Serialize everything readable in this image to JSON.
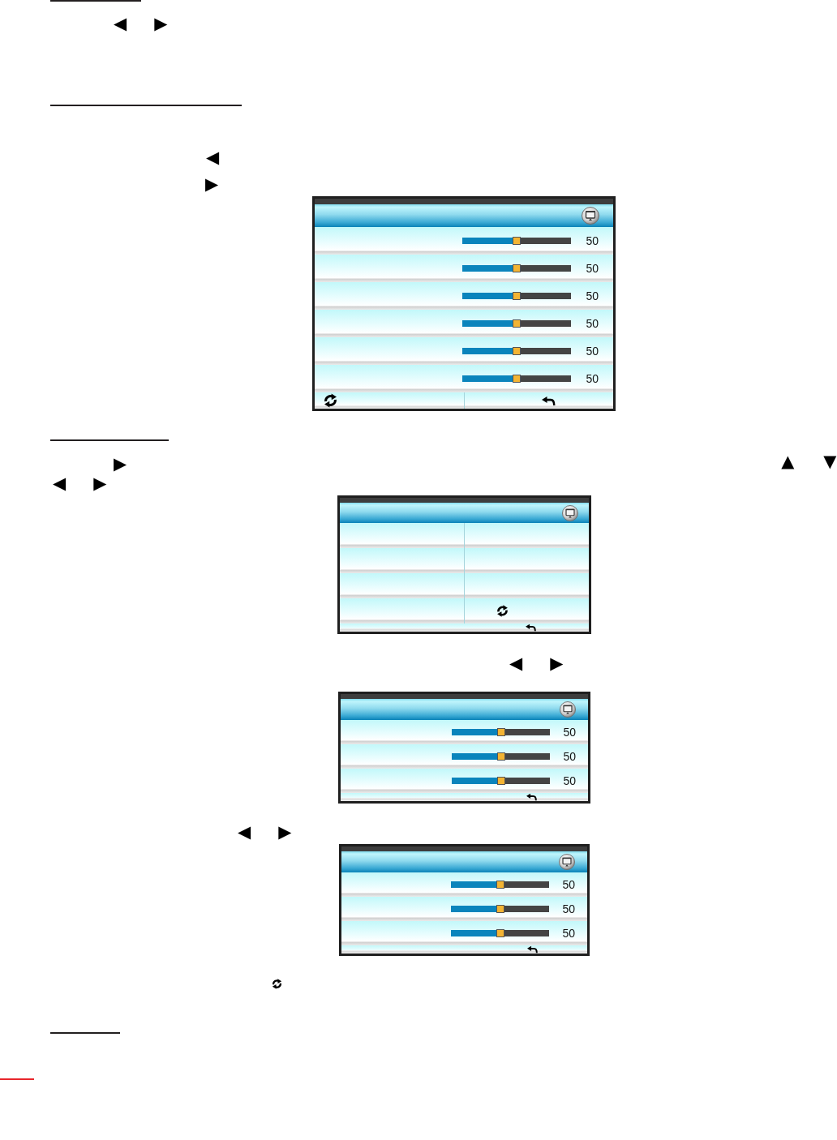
{
  "blocks": [
    {
      "kind": "rule"
    },
    {
      "kind": "keys",
      "keys": [
        "◀",
        "▶"
      ]
    },
    {
      "kind": "rule"
    },
    {
      "kind": "keys",
      "keys": [
        "◀"
      ]
    },
    {
      "kind": "keys",
      "keys": [
        "▶"
      ]
    },
    {
      "kind": "menu",
      "rows": [
        {
          "kind": "slider",
          "level": 0.5,
          "reading": "50"
        },
        {
          "kind": "slider",
          "level": 0.5,
          "reading": "50"
        },
        {
          "kind": "slider",
          "level": 0.5,
          "reading": "50"
        },
        {
          "kind": "slider",
          "level": 0.5,
          "reading": "50"
        },
        {
          "kind": "slider",
          "level": 0.5,
          "reading": "50"
        },
        {
          "kind": "slider",
          "level": 0.5,
          "reading": "50"
        }
      ],
      "footer": {
        "kind": "reset_back"
      }
    },
    {
      "kind": "rule"
    },
    {
      "kind": "keys",
      "keys": [
        "▶",
        "▲",
        "▼"
      ]
    },
    {
      "kind": "keys",
      "keys": [
        "◀",
        "▶"
      ]
    },
    {
      "kind": "menu",
      "rows": [
        {
          "kind": "split"
        },
        {
          "kind": "split"
        },
        {
          "kind": "split"
        },
        {
          "kind": "split_reset"
        }
      ],
      "footer": {
        "kind": "back"
      }
    },
    {
      "kind": "keys",
      "keys": [
        "◀",
        "▶"
      ]
    },
    {
      "kind": "menu",
      "rows": [
        {
          "kind": "slider",
          "level": 0.5,
          "reading": "50"
        },
        {
          "kind": "slider",
          "level": 0.5,
          "reading": "50"
        },
        {
          "kind": "slider",
          "level": 0.5,
          "reading": "50"
        }
      ],
      "footer": {
        "kind": "back"
      }
    },
    {
      "kind": "keys",
      "keys": [
        "◀",
        "▶"
      ]
    },
    {
      "kind": "menu",
      "rows": [
        {
          "kind": "slider",
          "level": 0.5,
          "reading": "50"
        },
        {
          "kind": "slider",
          "level": 0.5,
          "reading": "50"
        },
        {
          "kind": "slider",
          "level": 0.5,
          "reading": "50"
        }
      ],
      "footer": {
        "kind": "back"
      }
    },
    {
      "kind": "icon"
    },
    {
      "kind": "rule"
    }
  ]
}
